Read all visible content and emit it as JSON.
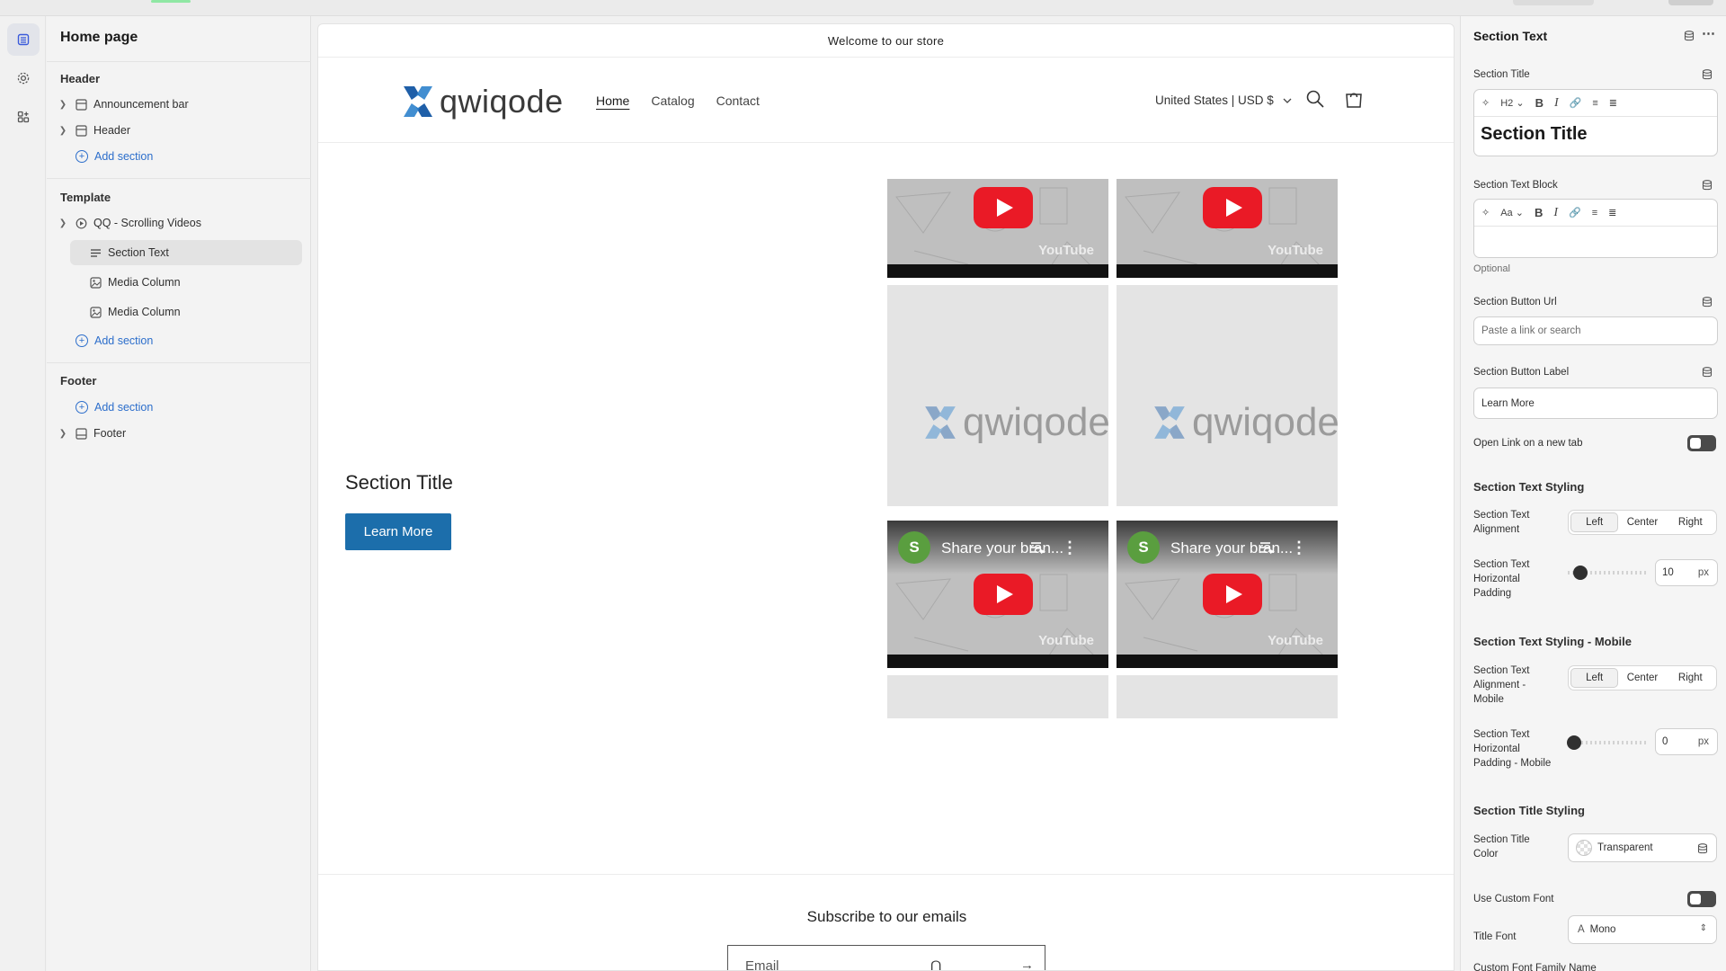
{
  "sidebar": {
    "title": "Home page",
    "groups": {
      "header": "Header",
      "template": "Template",
      "footer": "Footer"
    },
    "items": {
      "announcement_bar": "Announcement bar",
      "header": "Header",
      "add_section": "Add section",
      "scrolling_videos": "QQ - Scrolling Videos",
      "section_text": "Section Text",
      "media_column_1": "Media Column",
      "media_column_2": "Media Column",
      "footer": "Footer"
    }
  },
  "preview": {
    "announcement": "Welcome to our store",
    "logo_text": "qwiqode",
    "nav": [
      "Home",
      "Catalog",
      "Contact"
    ],
    "country": "United States | USD $",
    "section_title": "Section Title",
    "button_label": "Learn More",
    "video_brand": "YouTube",
    "share_title": "Share your bran...",
    "share_logo_letter": "S",
    "subscribe_title": "Subscribe to our emails",
    "email_placeholder": "Email"
  },
  "settings": {
    "title": "Section Text",
    "section_title_label": "Section Title",
    "heading_level": "H2",
    "section_title_value": "Section Title",
    "text_block_label": "Section Text Block",
    "text_style": "Aa",
    "optional": "Optional",
    "button_url_label": "Section Button Url",
    "button_url_placeholder": "Paste a link or search",
    "button_label_label": "Section Button Label",
    "button_label_value": "Learn More",
    "open_new_tab": "Open Link on a new tab",
    "open_new_tab_enabled": false,
    "styling_head": "Section Text Styling",
    "alignment_label": "Section Text Alignment",
    "alignment_options": [
      "Left",
      "Center",
      "Right"
    ],
    "alignment_selected": "Left",
    "padding_label": "Section Text Horizontal Padding",
    "padding_value": "10",
    "padding_unit": "px",
    "mobile_head": "Section Text Styling - Mobile",
    "mobile_alignment_label": "Section Text Alignment - Mobile",
    "mobile_alignment_selected": "Left",
    "mobile_padding_label": "Section Text Horizontal Padding - Mobile",
    "mobile_padding_value": "0",
    "title_styling_head": "Section Title Styling",
    "title_color_label": "Section Title Color",
    "title_color_value": "Transparent",
    "custom_font_label": "Use Custom Font",
    "custom_font_enabled": false,
    "title_font_label": "Title Font",
    "title_font_value": "Mono",
    "custom_font_family_label": "Custom Font Family Name"
  },
  "colors": {
    "accent_blue": "#2c6ecb",
    "store_button": "#1c6eab",
    "youtube_red": "#ea1a26",
    "logo_blue": "#1f5fa8"
  }
}
